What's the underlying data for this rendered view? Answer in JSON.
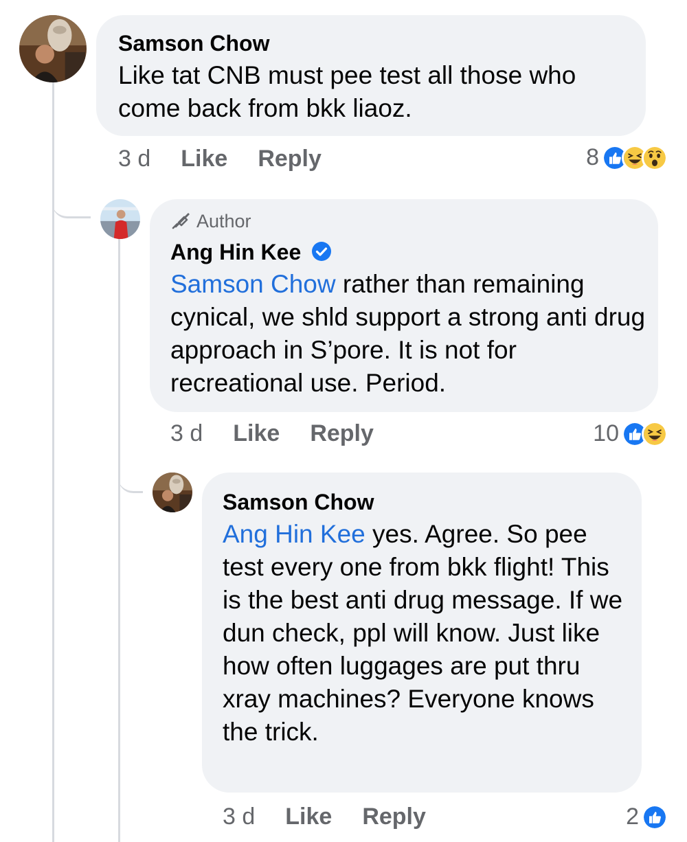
{
  "comments": [
    {
      "author": "Samson Chow",
      "text": "Like tat CNB must pee test all those who come back from bkk liaoz.",
      "time": "3 d",
      "like_label": "Like",
      "reply_label": "Reply",
      "reaction_count": "8",
      "reactions": [
        "like-icon",
        "haha-icon",
        "wow-icon"
      ]
    },
    {
      "badge": "Author",
      "author": "Ang Hin Kee",
      "verified": true,
      "mention": "Samson Chow",
      "text": " rather than remaining cynical, we shld support a strong anti drug approach in S’pore. It is not for recreational use. Period.",
      "time": "3 d",
      "like_label": "Like",
      "reply_label": "Reply",
      "reaction_count": "10",
      "reactions": [
        "like-icon",
        "haha-icon"
      ]
    },
    {
      "author": "Samson Chow",
      "mention": "Ang Hin Kee",
      "text": " yes. Agree. So pee test every one from bkk flight! This is the best anti drug message. If we dun check, ppl will know. Just like how often luggages are put thru xray machines? Everyone knows the trick.",
      "time": "3 d",
      "like_label": "Like",
      "reply_label": "Reply",
      "reaction_count": "2",
      "reactions": [
        "like-icon"
      ]
    }
  ],
  "colors": {
    "bubble": "#f0f2f5",
    "mention": "#216fdb",
    "meta": "#65676b",
    "like_blue": "#1877f2",
    "emoji_yellow": "#f7c944"
  }
}
